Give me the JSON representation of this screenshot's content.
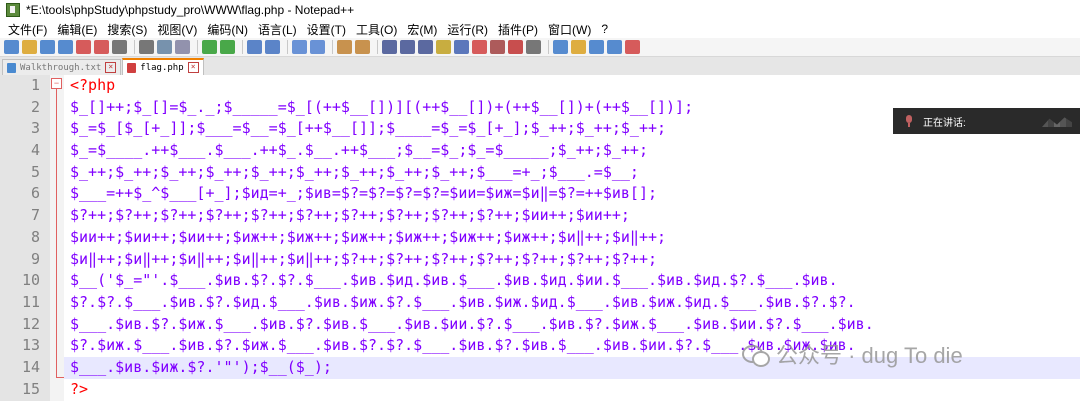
{
  "window": {
    "title": "*E:\\tools\\phpStudy\\phpstudy_pro\\WWW\\flag.php - Notepad++"
  },
  "menu": [
    "文件(F)",
    "编辑(E)",
    "搜索(S)",
    "视图(V)",
    "编码(N)",
    "语言(L)",
    "设置(T)",
    "工具(O)",
    "宏(M)",
    "运行(R)",
    "插件(P)",
    "窗口(W)",
    "?"
  ],
  "toolbar": {
    "groups": [
      [
        "new-file-icon",
        "open-file-icon",
        "save-icon",
        "save-all-icon",
        "close-icon",
        "close-all-icon",
        "print-icon"
      ],
      [
        "cut-icon",
        "copy-icon",
        "paste-icon"
      ],
      [
        "undo-icon",
        "redo-icon"
      ],
      [
        "find-icon",
        "replace-icon"
      ],
      [
        "zoom-in-icon",
        "zoom-out-icon"
      ],
      [
        "sync-vertical-icon",
        "sync-horizontal-icon"
      ],
      [
        "word-wrap-icon",
        "show-all-chars-icon",
        "indent-guide-icon",
        "doc-map-icon",
        "function-list-icon",
        "folder-workspace-icon",
        "monitor-icon",
        "lang-icon",
        "eye-icon"
      ],
      [
        "record-macro-icon",
        "stop-macro-icon",
        "play-macro-icon",
        "run-macro-icon",
        "save-macro-icon"
      ]
    ]
  },
  "tabs": [
    {
      "label": "Walkthrough.txt",
      "active": false
    },
    {
      "label": "flag.php",
      "active": true
    }
  ],
  "editor": {
    "current_line": 14,
    "lines": [
      {
        "n": "1",
        "text": "<?php",
        "kind": "tag"
      },
      {
        "n": "2",
        "text": "$_[]++;$_[]=$_._;$_____=$_[(++$__[])][(++$__[])+(++$__[])+(++$__[])];",
        "kind": "code"
      },
      {
        "n": "3",
        "text": "$_=$_[$_[+_]];$___=$__=$_[++$__[]];$____=$_=$_[+_];$_++;$_++;$_++;",
        "kind": "code"
      },
      {
        "n": "4",
        "text": "$_=$____.++$___.$___.++$_.$__.++$___;$__=$_;$_=$_____;$_++;$_++;",
        "kind": "code"
      },
      {
        "n": "5",
        "text": "$_++;$_++;$_++;$_++;$_++;$_++;$_++;$_++;$_++;$___=+_;$___.=$__;",
        "kind": "code"
      },
      {
        "n": "6",
        "text": "$___=++$_^$___[+_];$ид=+_;$ив=$?=$?=$?=$?=$ии=$иж=$и‖=$?=++$ив[];",
        "kind": "code"
      },
      {
        "n": "7",
        "text": "$?++;$?++;$?++;$?++;$?++;$?++;$?++;$?++;$?++;$?++;$ии++;$ии++;",
        "kind": "code"
      },
      {
        "n": "8",
        "text": "$ии++;$ии++;$ии++;$иж++;$иж++;$иж++;$иж++;$иж++;$иж++;$и‖++;$и‖++;",
        "kind": "code"
      },
      {
        "n": "9",
        "text": "$и‖++;$и‖++;$и‖++;$и‖++;$и‖++;$?++;$?++;$?++;$?++;$?++;$?++;$?++;",
        "kind": "code"
      },
      {
        "n": "10",
        "text": "$__('$_=\"'.$___.$ив.$?.$?.$___.$ив.$ид.$ив.$___.$ив.$ид.$ии.$___.$ив.$ид.$?.$___.$ив.",
        "kind": "code"
      },
      {
        "n": "11",
        "text": "$?.$?.$___.$ив.$?.$ид.$___.$ив.$иж.$?.$___.$ив.$иж.$ид.$___.$ив.$иж.$ид.$___.$ив.$?.$?.",
        "kind": "code"
      },
      {
        "n": "12",
        "text": "$___.$ив.$?.$иж.$___.$ив.$?.$ив.$___.$ив.$ии.$?.$___.$ив.$?.$иж.$___.$ив.$ии.$?.$___.$ив.",
        "kind": "code"
      },
      {
        "n": "13",
        "text": "$?.$иж.$___.$ив.$?.$иж.$___.$ив.$?.$?.$___.$ив.$?.$ив.$___.$ив.$ии.$?.$___.$ив.$иж.$ив.",
        "kind": "code"
      },
      {
        "n": "14",
        "text": "$___.$ив.$иж.$?.'\"');$__($_);",
        "kind": "code"
      },
      {
        "n": "15",
        "text": "?>",
        "kind": "tag"
      }
    ]
  },
  "overlay": {
    "speaking_label": "正在讲话:"
  },
  "watermark": {
    "text": "公众号 · dug To die"
  },
  "colors": {
    "code": "#8000ff",
    "tag": "#ff0000",
    "gutter": "#e4e4e4",
    "current_line": "#e8e8ff",
    "tab_accent": "#f08000"
  }
}
